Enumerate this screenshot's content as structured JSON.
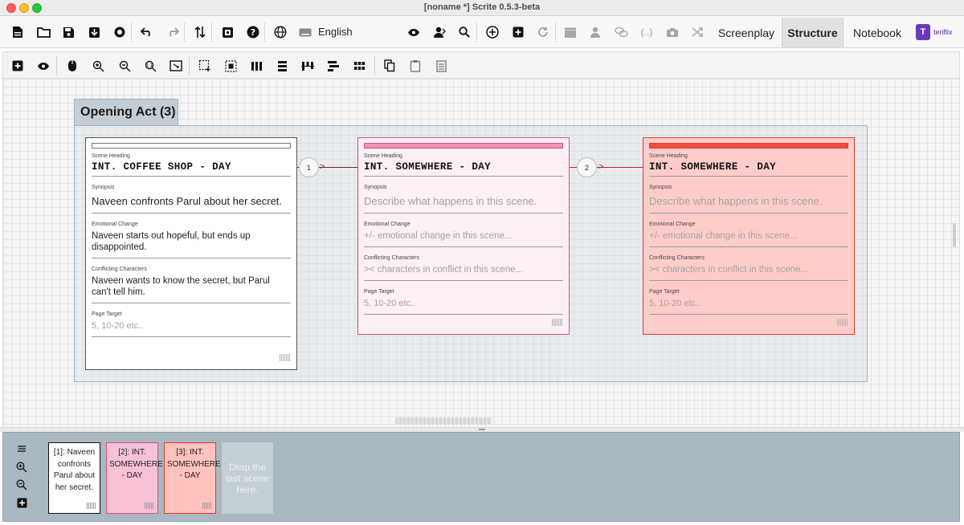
{
  "window": {
    "title": "[noname *] Scrite 0.5.3-beta"
  },
  "toolbar": {
    "language": "English",
    "icons": [
      "new-file-icon",
      "open-folder-icon",
      "save-icon",
      "export-icon",
      "award-icon",
      "undo-icon",
      "redo-icon",
      "sort-icon",
      "shortcuts-icon",
      "help-icon",
      "globe-icon",
      "keyboard-icon",
      "eye-icon",
      "character-icon",
      "search-icon",
      "add-scene-icon",
      "add-icon",
      "refresh-icon",
      "clapperboard-icon",
      "characters-icon",
      "comments-icon",
      "parentheses-icon",
      "camera-icon",
      "shuffle-icon"
    ],
    "modes": [
      {
        "label": "Screenplay",
        "active": false
      },
      {
        "label": "Structure",
        "active": true
      },
      {
        "label": "Notebook",
        "active": false
      }
    ],
    "logo_text": "teriflix"
  },
  "structure_toolbar": {
    "icons": [
      "add-scene-icon",
      "preview-icon",
      "mouse-icon",
      "zoom-in-icon",
      "zoom-out-icon",
      "zoom-one-icon",
      "fit-icon",
      "select-icon",
      "select-all-icon",
      "distribute-horizontal-icon",
      "distribute-vertical-icon",
      "align-top-icon",
      "align-left-icon",
      "grid-icon",
      "copy-icon",
      "paste-icon",
      "notes-icon"
    ]
  },
  "canvas": {
    "act_title": "Opening Act (3)",
    "connectors": [
      "1",
      "2"
    ],
    "scenes": [
      {
        "color": "#ffffff",
        "bar_color": "#ffffff",
        "border_color": "#555555",
        "heading_label": "Scene Heading",
        "heading": "INT. COFFEE SHOP - DAY",
        "synopsis_label": "Synopsis",
        "synopsis": "Naveen confronts Parul about her secret.",
        "emotional_label": "Emotional Change",
        "emotional": "Naveen starts out hopeful, but ends up disappointed.",
        "conflict_label": "Conflicting Characters",
        "conflict": "Naveen wants to know the secret, but Parul can't tell him.",
        "page_target_label": "Page Target",
        "page_target": "5, 10-20 etc.."
      },
      {
        "color": "#fdf0f4",
        "bar_color": "#f291b4",
        "border_color": "#d94f87",
        "heading_label": "Scene Heading",
        "heading": "INT. SOMEWHERE - DAY",
        "synopsis_label": "Synopsis",
        "synopsis": "Describe what happens in this scene.",
        "emotional_label": "Emotional Change",
        "emotional": "+/- emotional change in this scene...",
        "conflict_label": "Conflicting Characters",
        "conflict": ">< characters in conflict in this scene...",
        "page_target_label": "Page Target",
        "page_target": "5, 10-20 etc.."
      },
      {
        "color": "#ffcdc9",
        "bar_color": "#ee4b3e",
        "border_color": "#e8392e",
        "heading_label": "Scene Heading",
        "heading": "INT. SOMEWHERE - DAY",
        "synopsis_label": "Synopsis",
        "synopsis": "Describe what happens in this scene.",
        "emotional_label": "Emotional Change",
        "emotional": "+/- emotional change in this scene...",
        "conflict_label": "Conflicting Characters",
        "conflict": ">< characters in conflict in this scene...",
        "page_target_label": "Page Target",
        "page_target": "5, 10-20 etc.."
      }
    ]
  },
  "timeline": {
    "icons": [
      "list-icon",
      "zoom-in-icon",
      "zoom-out-icon",
      "add-icon"
    ],
    "cards": [
      {
        "text": "[1]: Naveen confronts Parul about her secret.",
        "color": "#ffffff",
        "border_color": "#111111"
      },
      {
        "text": "[2]: INT. SOMEWHERE - DAY",
        "color": "#f7c1d6",
        "border_color": "#d94f87"
      },
      {
        "text": "[3]: INT. SOMEWHERE - DAY",
        "color": "#ffc2bd",
        "border_color": "#e8392e"
      }
    ],
    "drop_text": "Drop the last scene here."
  }
}
